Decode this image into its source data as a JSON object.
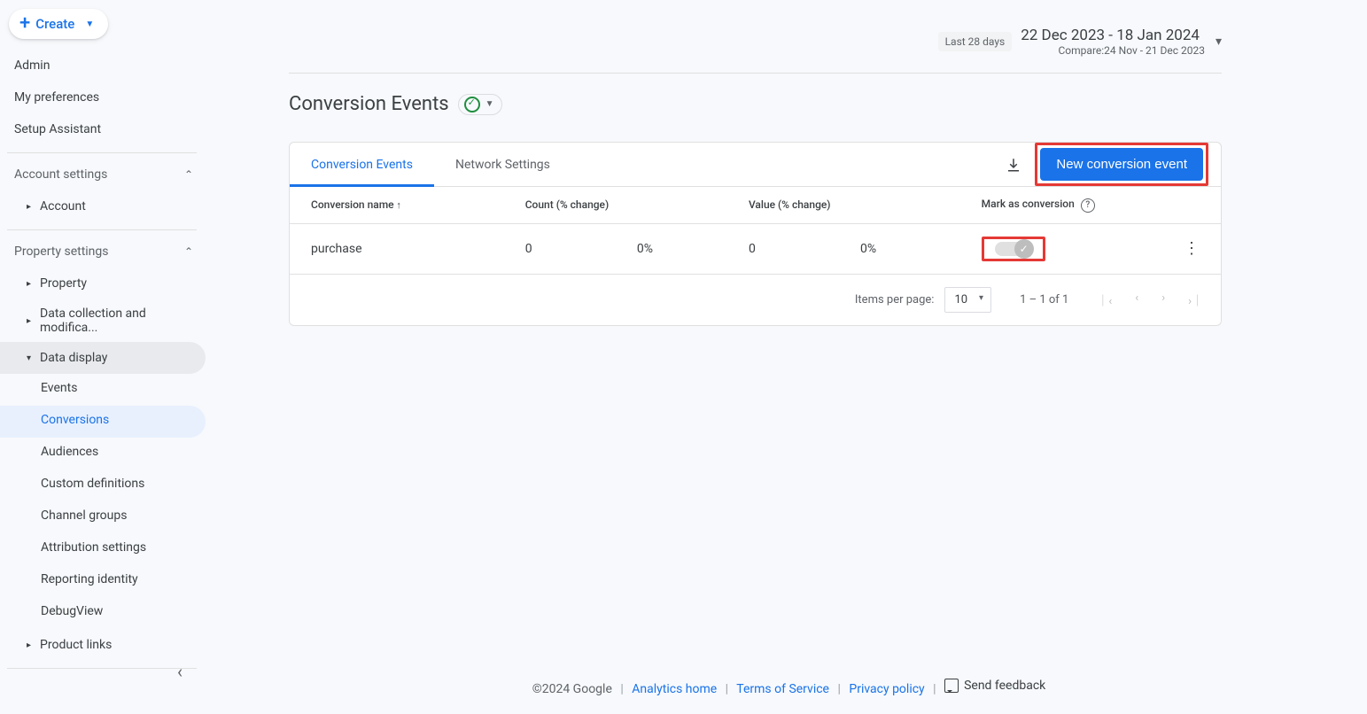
{
  "create_label": "Create",
  "sidebar": {
    "top": [
      {
        "label": "Admin"
      },
      {
        "label": "My preferences"
      },
      {
        "label": "Setup Assistant"
      }
    ],
    "groups": {
      "account": {
        "label": "Account settings",
        "items": [
          {
            "label": "Account"
          }
        ]
      },
      "property": {
        "label": "Property settings",
        "items": [
          {
            "label": "Property",
            "kind": "sub"
          },
          {
            "label": "Data collection and modifica...",
            "kind": "sub"
          },
          {
            "label": "Data display",
            "kind": "sub",
            "open": true,
            "active_parent": true,
            "children": [
              {
                "label": "Events"
              },
              {
                "label": "Conversions",
                "active": true
              },
              {
                "label": "Audiences"
              },
              {
                "label": "Custom definitions"
              },
              {
                "label": "Channel groups"
              },
              {
                "label": "Attribution settings"
              },
              {
                "label": "Reporting identity"
              },
              {
                "label": "DebugView"
              }
            ]
          },
          {
            "label": "Product links",
            "kind": "sub"
          }
        ]
      }
    }
  },
  "date": {
    "chip": "Last 28 days",
    "range": "22 Dec 2023 - 18 Jan 2024",
    "compare": "Compare:24 Nov - 21 Dec 2023"
  },
  "page_title": "Conversion Events",
  "tabs": [
    {
      "label": "Conversion Events",
      "active": true
    },
    {
      "label": "Network Settings"
    }
  ],
  "new_event_btn": "New conversion event",
  "table": {
    "headers": {
      "name": "Conversion name",
      "count": "Count (% change)",
      "value": "Value (% change)",
      "mark": "Mark as conversion"
    },
    "rows": [
      {
        "name": "purchase",
        "count": "0",
        "count_pct": "0%",
        "value": "0",
        "value_pct": "0%"
      }
    ],
    "items_per_page_label": "Items per page:",
    "items_per_page_value": "10",
    "range_text": "1 – 1 of 1"
  },
  "footer": {
    "copyright": "©2024 Google",
    "links": {
      "analytics": "Analytics home",
      "tos": "Terms of Service",
      "privacy": "Privacy policy"
    },
    "feedback": "Send feedback"
  }
}
